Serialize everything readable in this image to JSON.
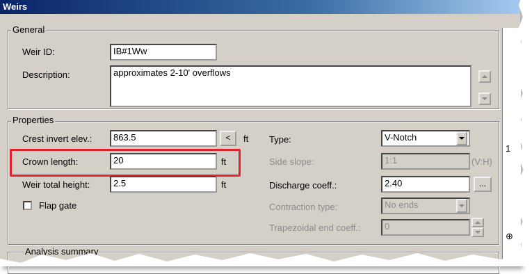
{
  "window": {
    "title": "Weirs"
  },
  "general": {
    "legend": "General",
    "weir_id_label": "Weir ID:",
    "weir_id_value": "IB#1Ww",
    "description_label": "Description:",
    "description_value": "approximates 2-10' overflows"
  },
  "properties": {
    "legend": "Properties",
    "crest_label": "Crest invert elev.:",
    "crest_value": "863.5",
    "crest_button": "<",
    "crest_unit": "ft",
    "crown_label": "Crown length:",
    "crown_value": "20",
    "crown_unit": "ft",
    "height_label": "Weir total height:",
    "height_value": "2.5",
    "height_unit": "ft",
    "flap_label": "Flap gate",
    "flap_checked": false,
    "type_label": "Type:",
    "type_value": "V-Notch",
    "side_slope_label": "Side slope:",
    "side_slope_value": "1:1",
    "side_slope_unit": "(V:H)",
    "discharge_label": "Discharge coeff.:",
    "discharge_value": "2.40",
    "discharge_button": "...",
    "contraction_label": "Contraction type:",
    "contraction_value": "No ends",
    "trap_label": "Trapezoidal end coeff.:",
    "trap_value": "0"
  },
  "analysis": {
    "legend": "Analysis summary"
  },
  "right_edge": {
    "char1": "1",
    "char2": "⊕"
  },
  "colors": {
    "highlight": "#e0232b",
    "title_start": "#0a246a",
    "dialog_bg": "#d4d0c8"
  }
}
